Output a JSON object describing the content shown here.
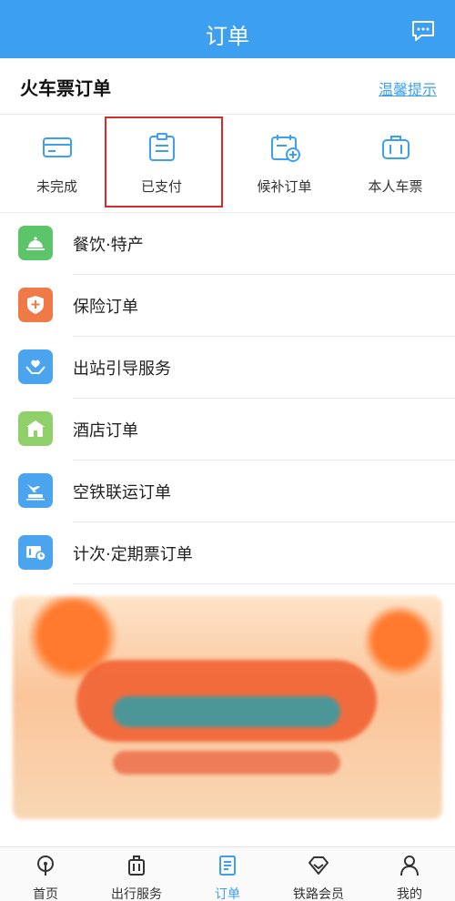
{
  "header": {
    "title": "订单",
    "message_icon": "message-icon"
  },
  "section": {
    "title": "火车票订单",
    "tip_link": "温馨提示"
  },
  "tabs": [
    {
      "label": "未完成",
      "icon": "card-icon"
    },
    {
      "label": "已支付",
      "icon": "clipboard-icon"
    },
    {
      "label": "候补订单",
      "icon": "calendar-add-icon"
    },
    {
      "label": "本人车票",
      "icon": "suitcase-icon"
    }
  ],
  "list": [
    {
      "label": "餐饮·特产",
      "icon": "service-bell-icon",
      "color": "#5cc56a"
    },
    {
      "label": "保险订单",
      "icon": "shield-plus-icon",
      "color": "#f07a47"
    },
    {
      "label": "出站引导服务",
      "icon": "hands-heart-icon",
      "color": "#4aa4ee"
    },
    {
      "label": "酒店订单",
      "icon": "hotel-icon",
      "color": "#8fd06a"
    },
    {
      "label": "空铁联运订单",
      "icon": "plane-train-icon",
      "color": "#4aa4ee"
    },
    {
      "label": "计次·定期票订单",
      "icon": "ticket-clock-icon",
      "color": "#4aa4ee"
    }
  ],
  "bottom_nav": [
    {
      "label": "首页",
      "icon": "train-icon"
    },
    {
      "label": "出行服务",
      "icon": "luggage-icon"
    },
    {
      "label": "订单",
      "icon": "order-doc-icon",
      "active": true
    },
    {
      "label": "铁路会员",
      "icon": "diamond-icon"
    },
    {
      "label": "我的",
      "icon": "person-icon"
    }
  ],
  "colors": {
    "brand": "#3d9ff0",
    "highlight_box": "#d42b2b"
  }
}
